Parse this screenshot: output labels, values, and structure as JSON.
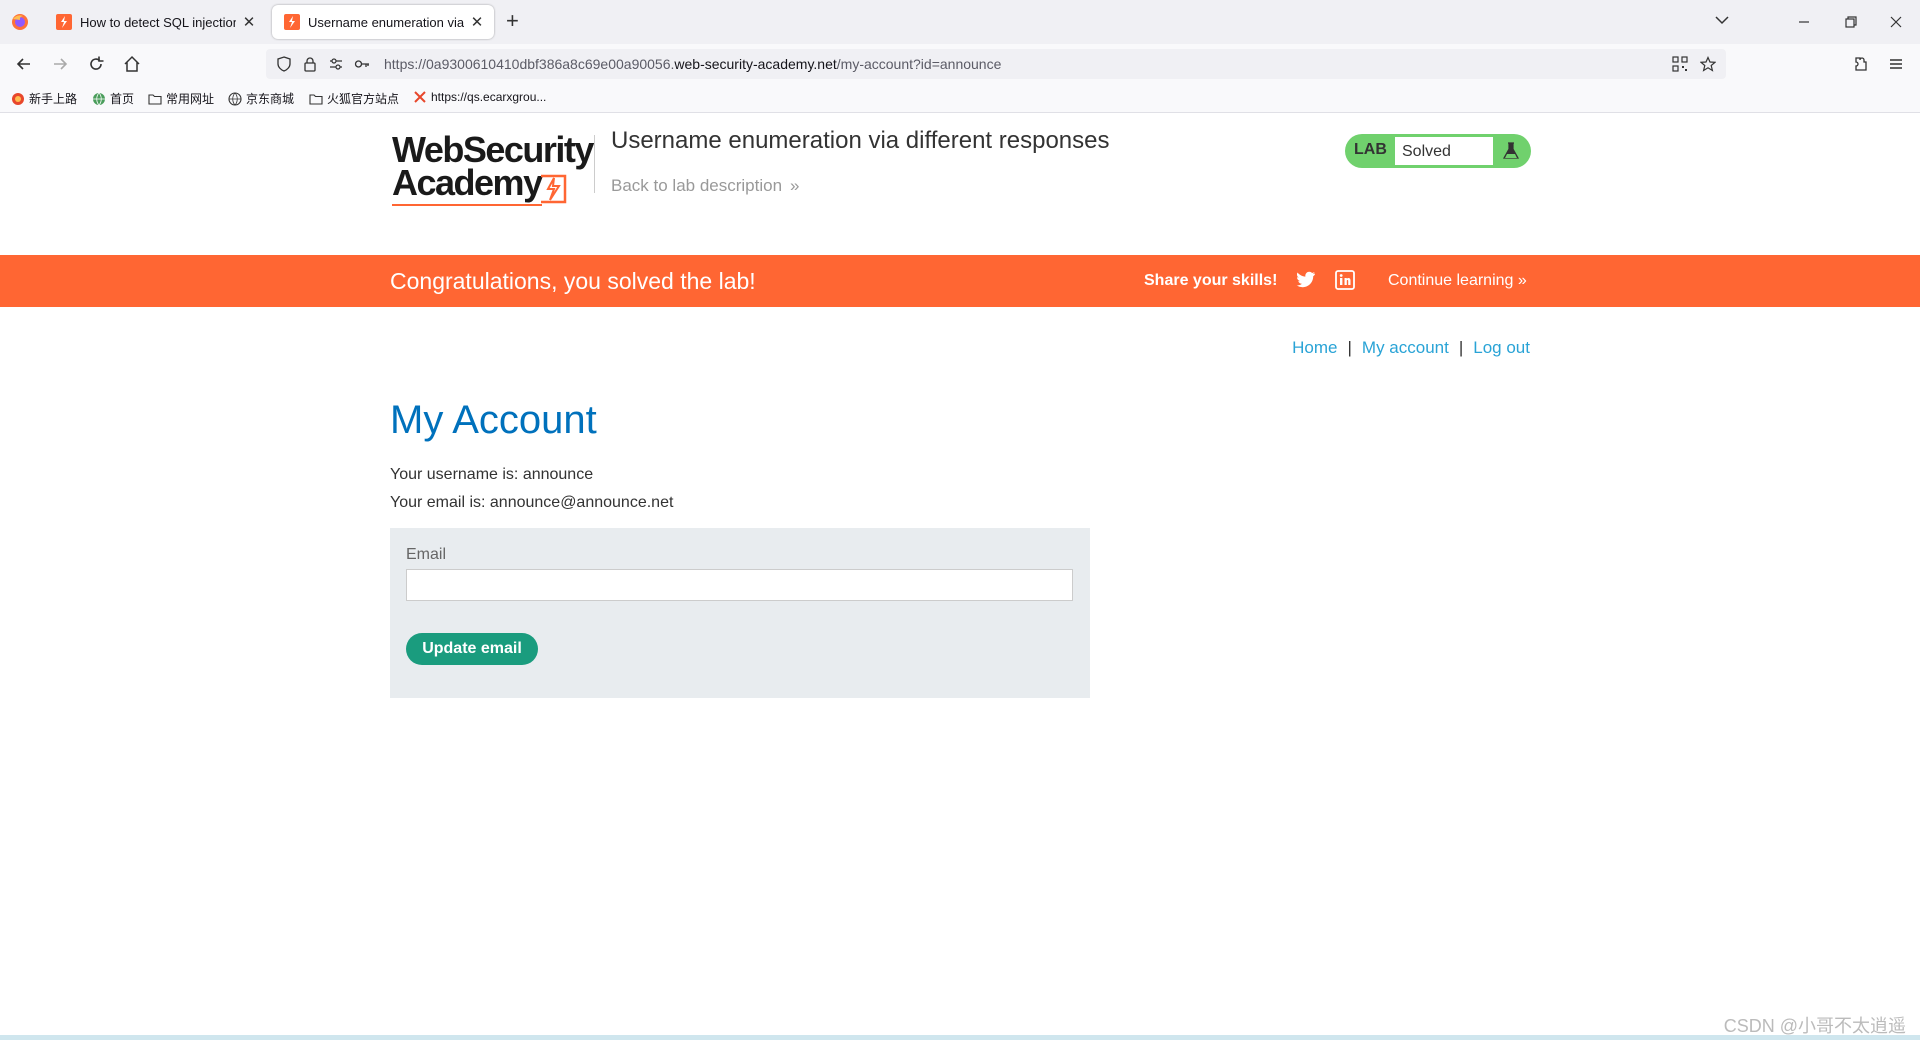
{
  "browser": {
    "tabs": [
      {
        "title": "How to detect SQL injection",
        "active": false
      },
      {
        "title": "Username enumeration via di",
        "active": true
      }
    ],
    "new_tab": "+",
    "url": {
      "prefix": "https://0a9300610410dbf386a8c69e00a90056.",
      "domain": "web-security-academy.net",
      "path": "/my-account?id=announce"
    },
    "bookmarks": [
      {
        "label": "新手上路",
        "icon": "firefox-icon"
      },
      {
        "label": "首页",
        "icon": "globe-icon"
      },
      {
        "label": "常用网址",
        "icon": "folder-icon"
      },
      {
        "label": "京东商城",
        "icon": "globe-icon"
      },
      {
        "label": "火狐官方站点",
        "icon": "folder-icon"
      },
      {
        "label": "https://qs.ecarxgrou...",
        "icon": "x-icon"
      }
    ]
  },
  "header": {
    "logo_line1": "WebSecurity",
    "logo_line2": "Academy",
    "lab_title": "Username enumeration via different responses",
    "back_link": "Back to lab description",
    "back_chevron": "»",
    "badge_tag": "LAB",
    "badge_status": "Solved"
  },
  "banner": {
    "message": "Congratulations, you solved the lab!",
    "share": "Share your skills!",
    "continue": "Continue learning",
    "continue_chevron": "»"
  },
  "nav": {
    "home": "Home",
    "my_account": "My account",
    "log_out": "Log out",
    "sep": "|"
  },
  "account": {
    "heading": "My Account",
    "username_line": "Your username is: announce",
    "email_line": "Your email is: announce@announce.net",
    "email_label": "Email",
    "email_value": "",
    "update_button": "Update email"
  },
  "watermark": "CSDN @小哥不太逍遥",
  "colors": {
    "accent_orange": "#ff6633",
    "heading_blue": "#0071bc",
    "link_blue": "#29a3d6",
    "button_green": "#1a9c7e",
    "badge_green": "#70d16d"
  }
}
